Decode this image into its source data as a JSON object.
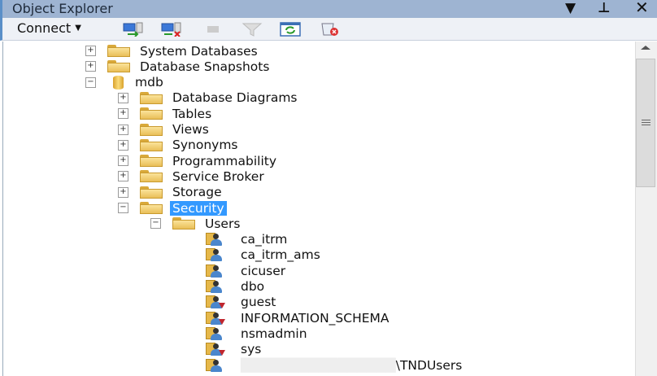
{
  "title": "Object Explorer",
  "title_controls": [
    "dropdown-icon",
    "pin-icon",
    "close-icon"
  ],
  "toolbar": {
    "connect_label": "Connect",
    "buttons": [
      "connect-object-explorer",
      "disconnect",
      "stop",
      "filter",
      "refresh",
      "remove-filter"
    ]
  },
  "tree": [
    {
      "level": 0,
      "label": "System Databases",
      "expander": "+",
      "icon": "folder"
    },
    {
      "level": 0,
      "label": "Database Snapshots",
      "expander": "+",
      "icon": "folder"
    },
    {
      "level": 0,
      "label": "mdb",
      "expander": "−",
      "icon": "database"
    },
    {
      "level": 1,
      "label": "Database Diagrams",
      "expander": "+",
      "icon": "folder"
    },
    {
      "level": 1,
      "label": "Tables",
      "expander": "+",
      "icon": "folder"
    },
    {
      "level": 1,
      "label": "Views",
      "expander": "+",
      "icon": "folder"
    },
    {
      "level": 1,
      "label": "Synonyms",
      "expander": "+",
      "icon": "folder"
    },
    {
      "level": 1,
      "label": "Programmability",
      "expander": "+",
      "icon": "folder"
    },
    {
      "level": 1,
      "label": "Service Broker",
      "expander": "+",
      "icon": "folder"
    },
    {
      "level": 1,
      "label": "Storage",
      "expander": "+",
      "icon": "folder"
    },
    {
      "level": 1,
      "label": "Security",
      "expander": "−",
      "icon": "folder",
      "selected": true
    },
    {
      "level": 2,
      "label": "Users",
      "expander": "−",
      "icon": "folder"
    },
    {
      "level": 3,
      "label": "ca_itrm",
      "icon": "user"
    },
    {
      "level": 3,
      "label": "ca_itrm_ams",
      "icon": "user"
    },
    {
      "level": 3,
      "label": "cicuser",
      "icon": "user"
    },
    {
      "level": 3,
      "label": "dbo",
      "icon": "user"
    },
    {
      "level": 3,
      "label": "guest",
      "icon": "user-disabled"
    },
    {
      "level": 3,
      "label": "INFORMATION_SCHEMA",
      "icon": "user-disabled"
    },
    {
      "level": 3,
      "label": "nsmadmin",
      "icon": "user"
    },
    {
      "level": 3,
      "label": "sys",
      "icon": "user-disabled"
    },
    {
      "level": 3,
      "label": "\\TNDUsers",
      "icon": "user",
      "redacted_prefix": true
    }
  ]
}
